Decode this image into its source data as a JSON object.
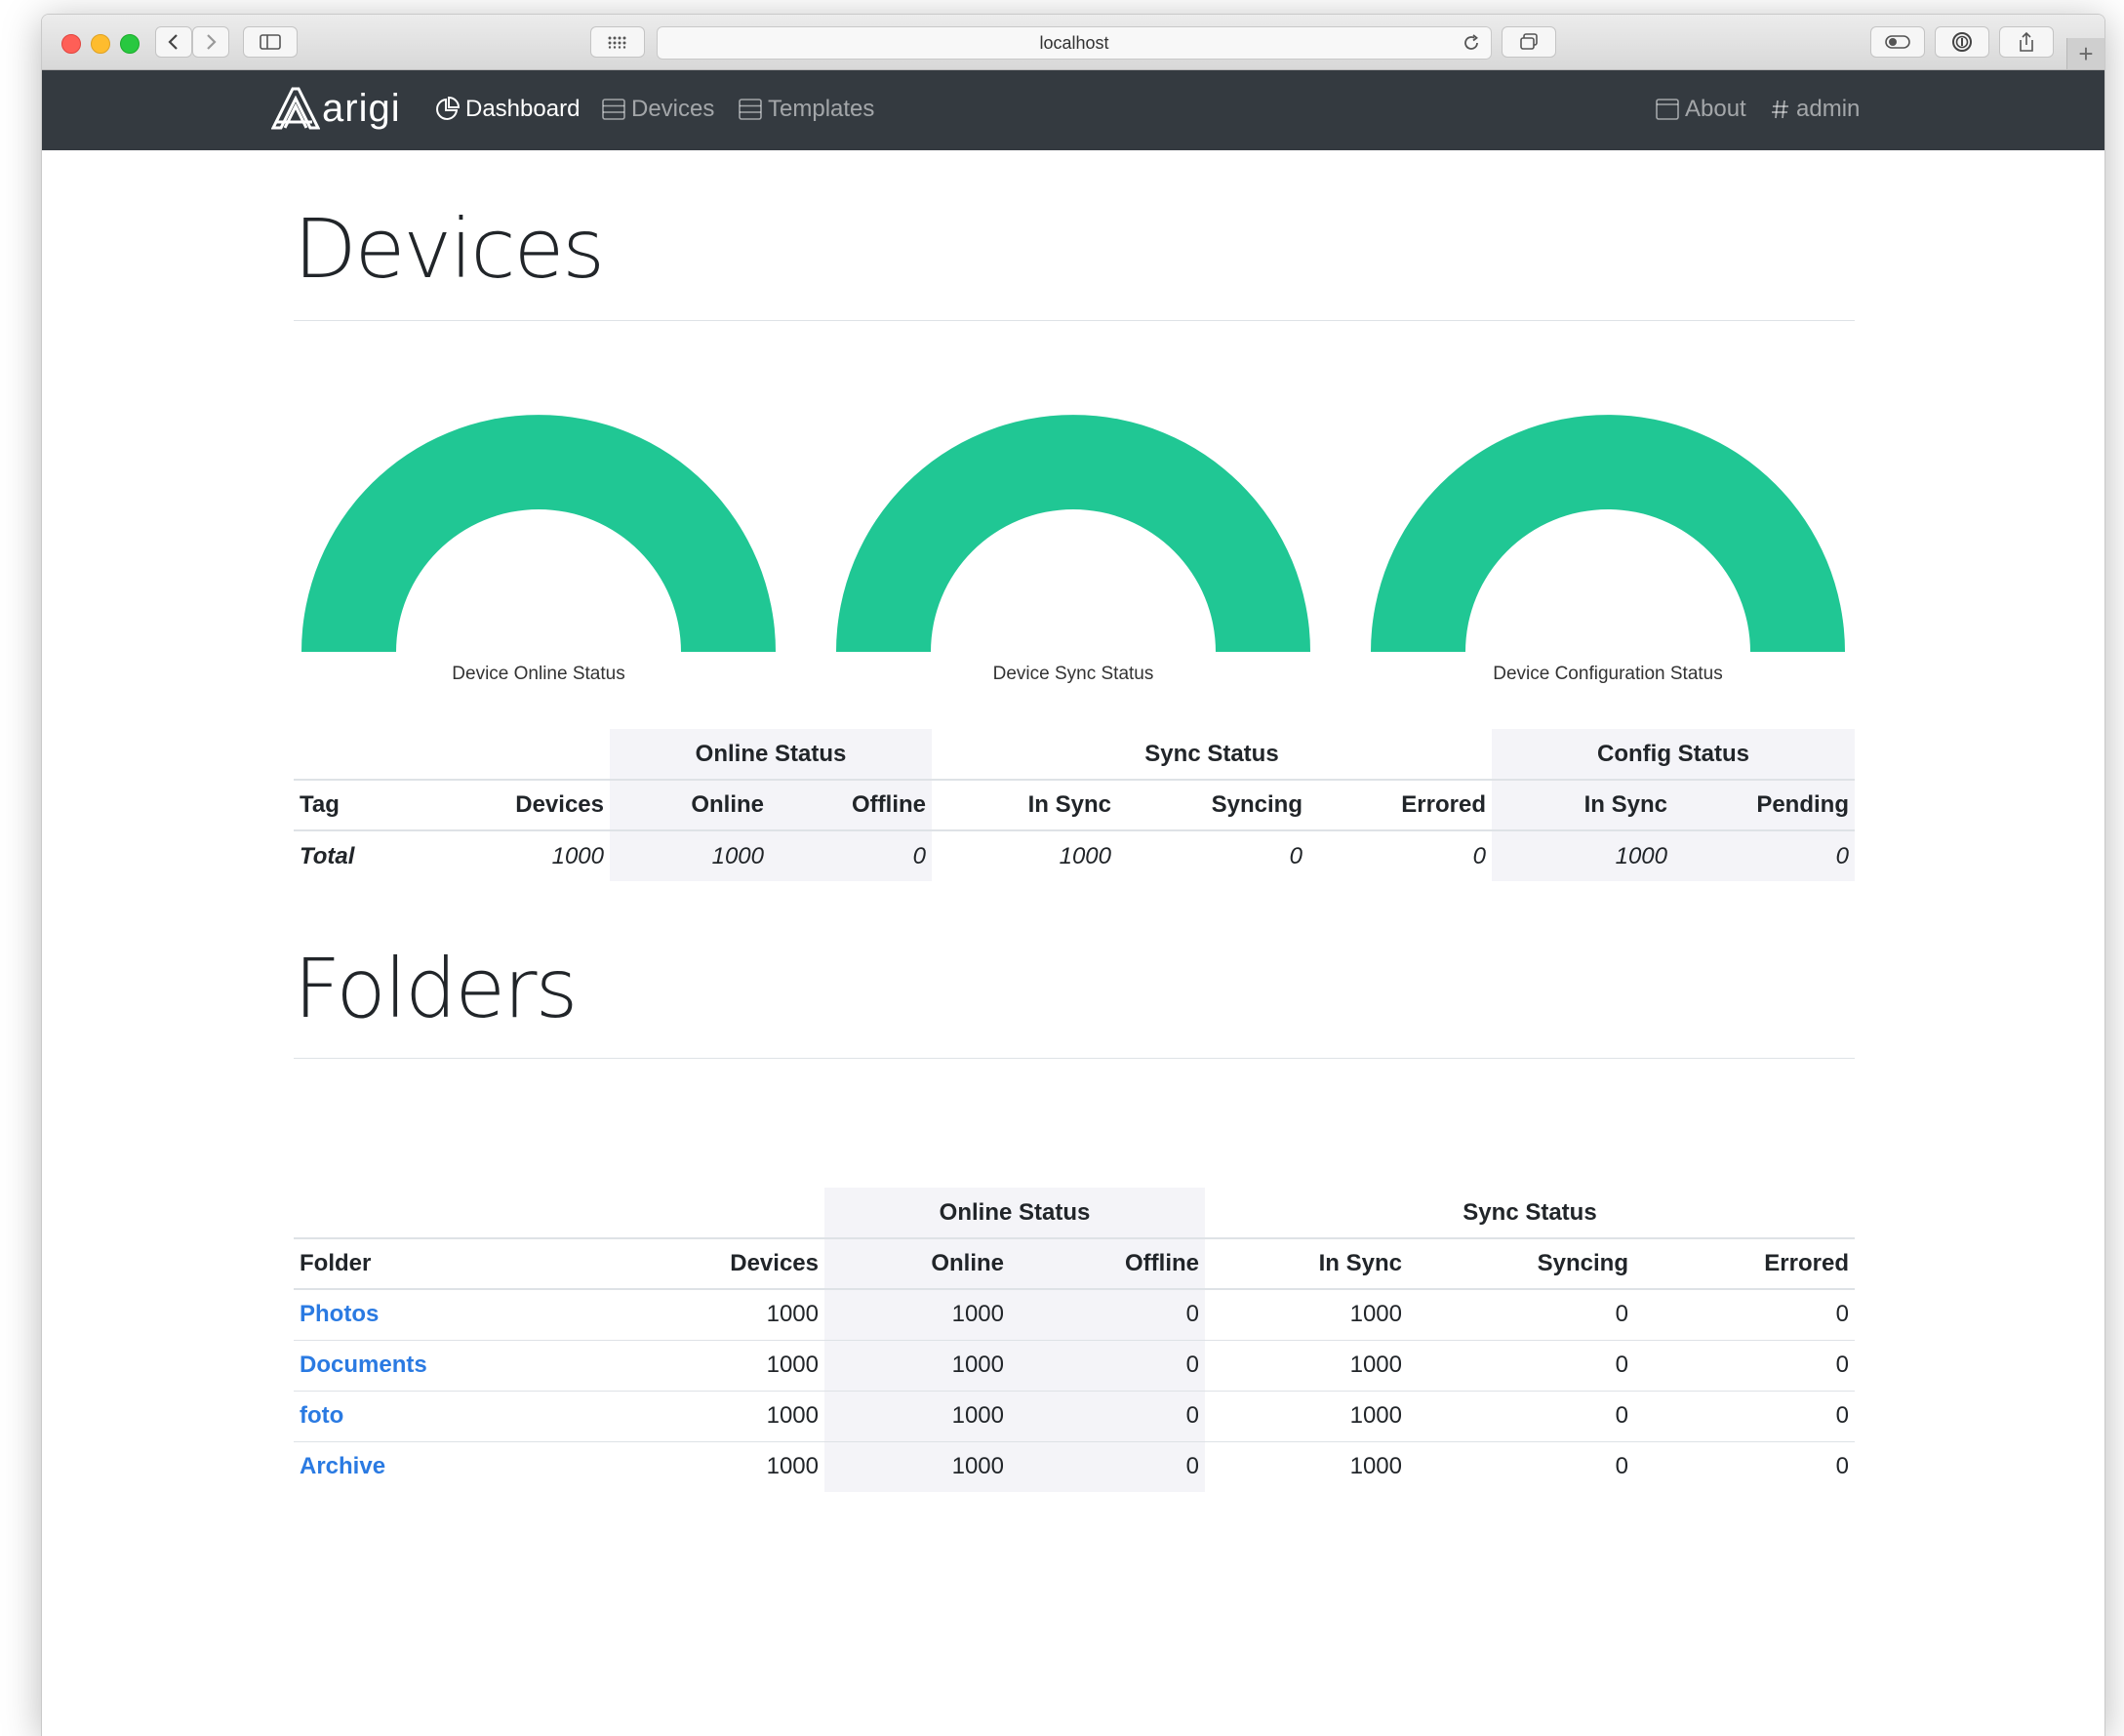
{
  "browser": {
    "url": "localhost"
  },
  "navbar": {
    "brand": "arigi",
    "items": [
      {
        "label": "Dashboard",
        "icon": "pie-chart-icon",
        "active": true
      },
      {
        "label": "Devices",
        "icon": "server-icon",
        "active": false
      },
      {
        "label": "Templates",
        "icon": "server-icon",
        "active": false
      }
    ],
    "right_items": [
      {
        "label": "About",
        "icon": "window-icon"
      },
      {
        "label": "admin",
        "icon": "hash-icon"
      }
    ]
  },
  "colors": {
    "gauge": "#20c794",
    "navbar": "#343a40",
    "link": "#2a7ae2"
  },
  "devices_section": {
    "title": "Devices",
    "gauges": [
      {
        "label": "Device Online Status",
        "fraction": 1.0
      },
      {
        "label": "Device Sync Status",
        "fraction": 1.0
      },
      {
        "label": "Device Configuration Status",
        "fraction": 1.0
      }
    ],
    "table": {
      "groups": {
        "online": "Online Status",
        "sync": "Sync Status",
        "config": "Config Status"
      },
      "columns": [
        "Tag",
        "Devices",
        "Online",
        "Offline",
        "In Sync",
        "Syncing",
        "Errored",
        "In Sync",
        "Pending"
      ],
      "total_row": [
        "Total",
        "1000",
        "1000",
        "0",
        "1000",
        "0",
        "0",
        "1000",
        "0"
      ]
    }
  },
  "folders_section": {
    "title": "Folders",
    "table": {
      "groups": {
        "online": "Online Status",
        "sync": "Sync Status"
      },
      "columns": [
        "Folder",
        "Devices",
        "Online",
        "Offline",
        "In Sync",
        "Syncing",
        "Errored"
      ],
      "rows": [
        [
          "Photos",
          "1000",
          "1000",
          "0",
          "1000",
          "0",
          "0"
        ],
        [
          "Documents",
          "1000",
          "1000",
          "0",
          "1000",
          "0",
          "0"
        ],
        [
          "foto",
          "1000",
          "1000",
          "0",
          "1000",
          "0",
          "0"
        ],
        [
          "Archive",
          "1000",
          "1000",
          "0",
          "1000",
          "0",
          "0"
        ]
      ]
    }
  }
}
